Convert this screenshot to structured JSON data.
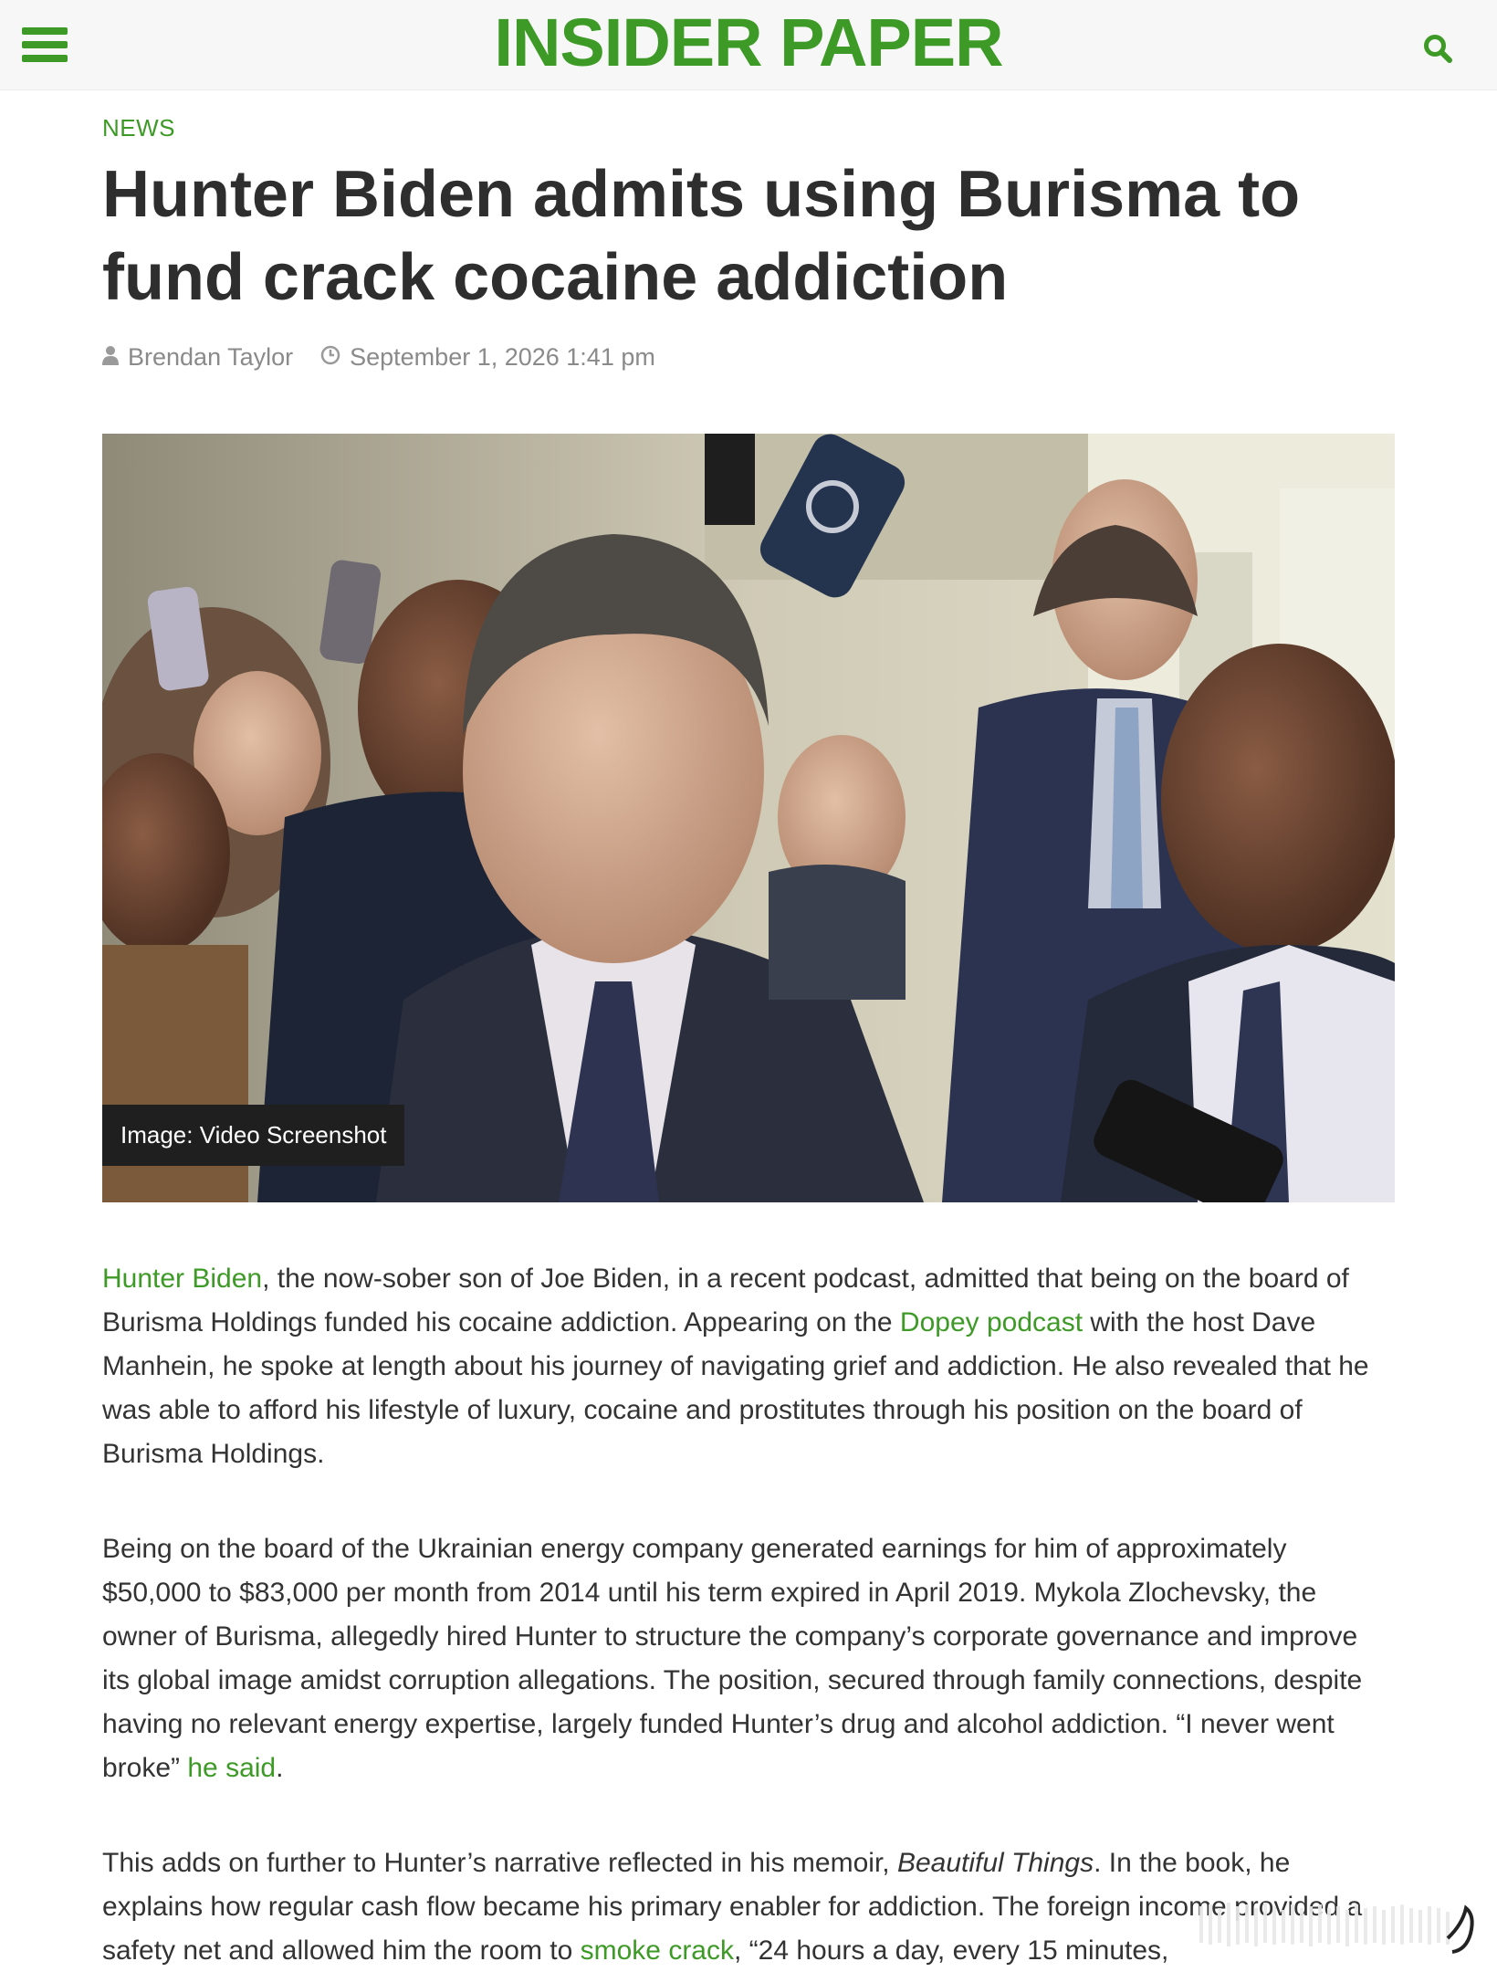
{
  "header": {
    "logo": "INSIDER PAPER",
    "menu_icon": "hamburger-menu-icon",
    "search_icon": "search-icon",
    "brand_color": "#3d9a26"
  },
  "article": {
    "category": "NEWS",
    "headline": "Hunter Biden admits using Burisma to fund crack cocaine addiction",
    "author": "Brendan Taylor",
    "date": "September 1, 2026 1:41 pm",
    "image_caption": "Image: Video Screenshot",
    "p1": {
      "link1": "Hunter Biden",
      "t1": ", the now-sober son of Joe Biden, in a recent podcast, admitted that being on the board of Burisma Holdings funded his cocaine addiction. Appearing on the ",
      "link2": "Dopey podcast",
      "t2": " with the host Dave Manhein, he spoke at length about his journey of navigating grief and addiction. He also revealed that he was able to afford his lifestyle of luxury, cocaine and prostitutes through his position on the board of Burisma Holdings."
    },
    "p2": {
      "t1": "Being on the board of the Ukrainian energy company generated earnings for him of approximately $50,000 to $83,000 per month from 2014 until his term expired in April 2019. Mykola Zlochevsky, the owner of Burisma, allegedly hired Hunter to structure the company’s corporate governance and improve its global image amidst corruption allegations. The position, secured through family connections, despite having no relevant energy expertise, largely funded Hunter’s drug and alcohol addiction. “I never went broke” ",
      "link1": "he said",
      "t2": "."
    },
    "p3": {
      "t1": "This adds on further to Hunter’s narrative reflected in his memoir, ",
      "book": "Beautiful Things",
      "t2": ". In the book, he explains how regular cash flow became his primary enabler for addiction. The foreign income provided a safety net and allowed him the room to ",
      "link1": "smoke crack",
      "t3": ", “24 hours a day, every 15 minutes,"
    }
  }
}
